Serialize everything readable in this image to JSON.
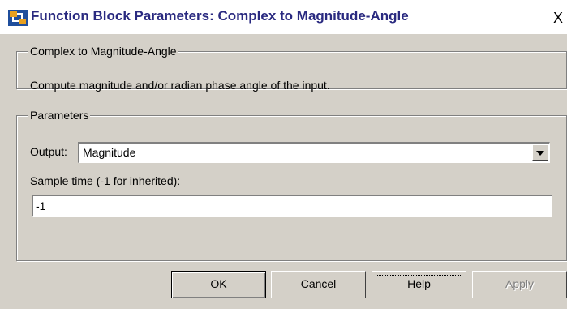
{
  "window": {
    "title": "Function Block Parameters: Complex to Magnitude-Angle",
    "close_glyph": "X"
  },
  "description_group": {
    "legend": "Complex to Magnitude-Angle",
    "text": "Compute magnitude and/or radian phase angle of the input."
  },
  "parameters_group": {
    "legend": "Parameters",
    "output_label": "Output:",
    "output_value": "Magnitude",
    "sample_time_label": "Sample time (-1 for inherited):",
    "sample_time_value": "-1"
  },
  "buttons": {
    "ok": "OK",
    "cancel": "Cancel",
    "help": "Help",
    "apply": "Apply"
  },
  "colors": {
    "title_text": "#2a2a80",
    "dialog_bg": "#d4d0c8"
  }
}
